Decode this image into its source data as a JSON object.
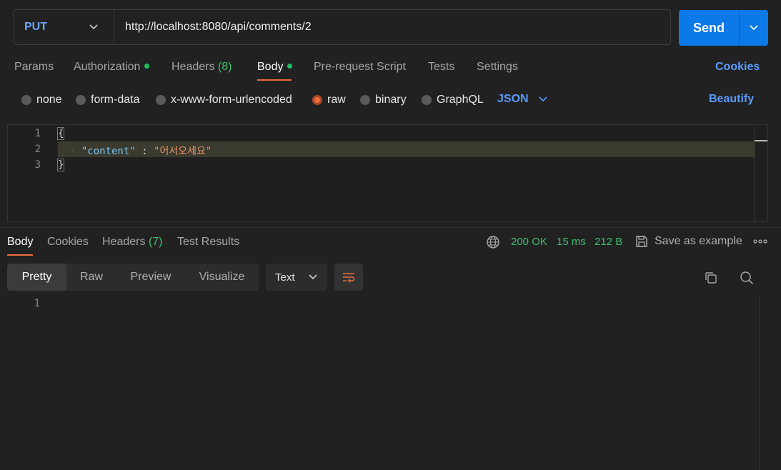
{
  "request": {
    "method": "PUT",
    "url": "http://localhost:8080/api/comments/2",
    "send_label": "Send"
  },
  "tabs": [
    {
      "label": "Params"
    },
    {
      "label": "Authorization"
    },
    {
      "label": "Headers",
      "count": "(8)"
    },
    {
      "label": "Body"
    },
    {
      "label": "Pre-request Script"
    },
    {
      "label": "Tests"
    },
    {
      "label": "Settings"
    }
  ],
  "cookies_link": "Cookies",
  "body_types": [
    "none",
    "form-data",
    "x-www-form-urlencoded",
    "raw",
    "binary",
    "GraphQL"
  ],
  "raw_format": "JSON",
  "beautify_label": "Beautify",
  "editor": {
    "line_numbers": [
      "1",
      "2",
      "3"
    ],
    "open_brace": "{",
    "key": "\"content\"",
    "separator": " : ",
    "value": "\"어서오세요\"",
    "close_brace": "}"
  },
  "response": {
    "tabs": [
      {
        "label": "Body"
      },
      {
        "label": "Cookies"
      },
      {
        "label": "Headers",
        "count": "(7)"
      },
      {
        "label": "Test Results"
      }
    ],
    "status": "200 OK",
    "time": "15 ms",
    "size": "212 B",
    "save_example": "Save as example",
    "view_modes": [
      "Pretty",
      "Raw",
      "Preview",
      "Visualize"
    ],
    "format": "Text",
    "line_numbers": [
      "1"
    ]
  },
  "colors": {
    "accent": "#f26b3a",
    "send": "#0b79e8",
    "status_ok": "#3fbf6e",
    "link": "#5b9cff"
  }
}
